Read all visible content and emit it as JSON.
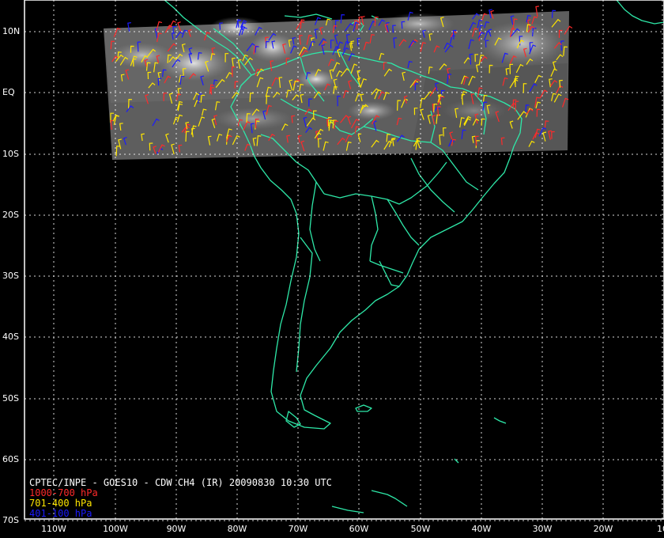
{
  "title": "CPTEC/INPE - GOES10 - CDW CH4 (IR) 20090830 10:30 UTC",
  "legend": [
    {
      "label": "1000-700 hPa",
      "color": "#ff2a2a"
    },
    {
      "label": "701-400 hPa",
      "color": "#ffe600"
    },
    {
      "label": "401-100 hPa",
      "color": "#1a1aff"
    }
  ],
  "lat_labels": [
    "10N",
    "EQ",
    "10S",
    "20S",
    "30S",
    "40S",
    "50S",
    "60S",
    "70S"
  ],
  "lon_labels": [
    "110W",
    "100W",
    "90W",
    "80W",
    "70W",
    "60W",
    "50W",
    "40W",
    "30W",
    "20W",
    "10"
  ],
  "colors": {
    "background": "#000000",
    "coastline": "#2ee8a8",
    "grid": "#ffffff",
    "ir_imagery": "#6a6a6a"
  }
}
